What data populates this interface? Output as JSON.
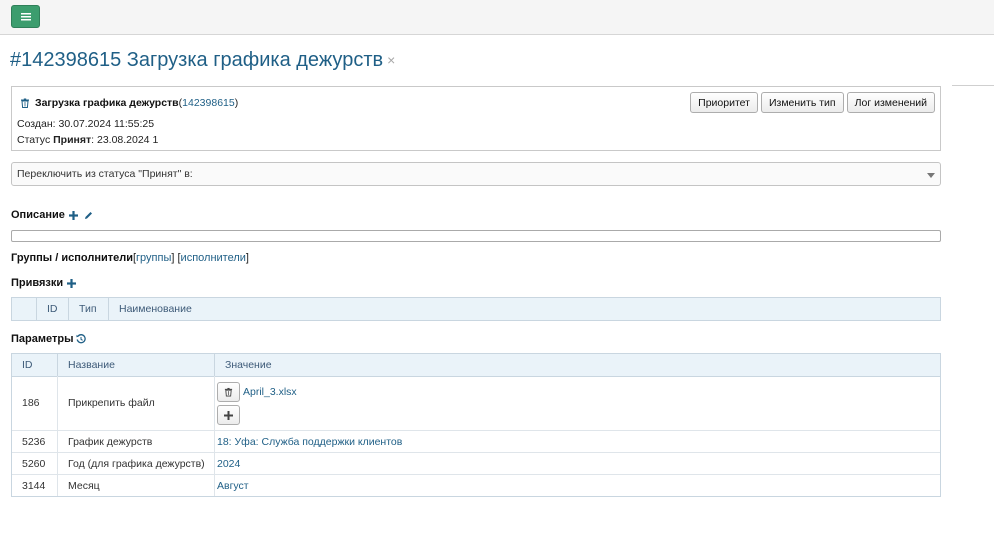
{
  "title": {
    "text": "#142398615 Загрузка графика дежурств",
    "close_symbol": "×"
  },
  "info": {
    "name": "Загрузка графика дежурств",
    "paren_open": " (",
    "id": "142398615",
    "paren_close": ")",
    "created": "Создан: 30.07.2024 11:55:25",
    "status_prefix": "Статус ",
    "status_value": "Принят",
    "status_suffix": ": 23.08.2024 1",
    "buttons": {
      "priority": "Приоритет",
      "change_type": "Изменить тип",
      "change_log": "Лог изменений"
    }
  },
  "status_switch": {
    "label": "Переключить из статуса \"Принят\" в:"
  },
  "description": {
    "heading": "Описание"
  },
  "groups": {
    "heading": "Группы / исполнители",
    "open1": " [",
    "groups_link": "группы",
    "mid": "] [",
    "executors_link": "исполнители",
    "close": "]"
  },
  "links": {
    "heading": "Привязки",
    "columns": [
      "ID",
      "Тип",
      "Наименование"
    ]
  },
  "params": {
    "heading": "Параметры",
    "columns": [
      "ID",
      "Название",
      "Значение"
    ],
    "rows": [
      {
        "id": "186",
        "name": "Прикрепить файл",
        "value": "April_3.xlsx"
      },
      {
        "id": "5236",
        "name": "График дежурств",
        "value": "18: Уфа: Служба поддержки клиентов"
      },
      {
        "id": "5260",
        "name": "Год (для графика дежурств)",
        "value": "2024"
      },
      {
        "id": "3144",
        "name": "Месяц",
        "value": "Август"
      }
    ]
  },
  "colors": {
    "accent": "#3c9d6e",
    "link": "#1f5f86",
    "grid_header": "#eaf3f9"
  },
  "icons": [
    "menu-icon",
    "close-icon",
    "trash-icon",
    "plus-icon",
    "pencil-icon",
    "history-icon",
    "chevron-down-icon"
  ]
}
